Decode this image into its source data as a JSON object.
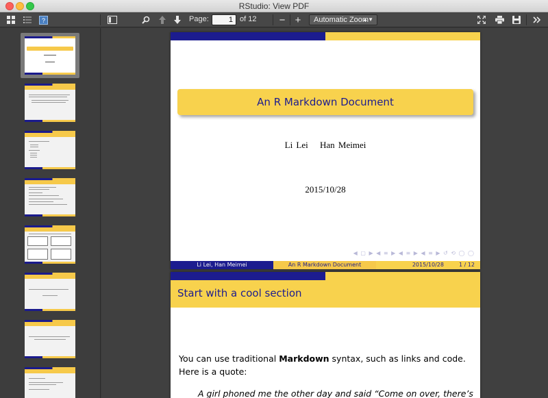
{
  "window": {
    "title": "RStudio: View PDF"
  },
  "toolbar": {
    "page_label": "Page:",
    "page_value": "1",
    "page_of": "of 12",
    "zoom_value": "Automatic Zoom",
    "zoom_out": "−",
    "zoom_in": "+",
    "icons": [
      "thumbnails-icon",
      "outline-icon",
      "attachments-icon",
      "sidebar-toggle-icon",
      "search-icon",
      "prev-page-icon",
      "next-page-icon",
      "fullscreen-icon",
      "print-icon",
      "download-icon",
      "more-tools-icon"
    ]
  },
  "slide1": {
    "title": "An R Markdown Document",
    "author1": "Li Lei",
    "author2": "Han Meimei",
    "date": "2015/10/28",
    "nav_symbols": "◀ ▢ ▶ ◀ ≡ ▶ ◀ ≡ ▶ ◀ ≡ ▶ ↺ ⟲ ◯ ◯",
    "footer_authors": "Li Lei, Han Meimei",
    "footer_title": "An R Markdown Document",
    "footer_date": "2015/10/28",
    "footer_page": "1 / 12"
  },
  "slide2": {
    "heading": "Start with a cool section",
    "text_before": "You can use traditional ",
    "text_bold": "Markdown",
    "text_after": " syntax, such as links and code. Here is a quote:",
    "quote": "A girl phoned me the other day and said “Come on over, there’s"
  },
  "colors": {
    "beamer_blue": "#1c1c8f",
    "beamer_yellow": "#f8d24d",
    "toolbar_bg": "#474747",
    "sidebar_bg": "#3d3d3d"
  }
}
